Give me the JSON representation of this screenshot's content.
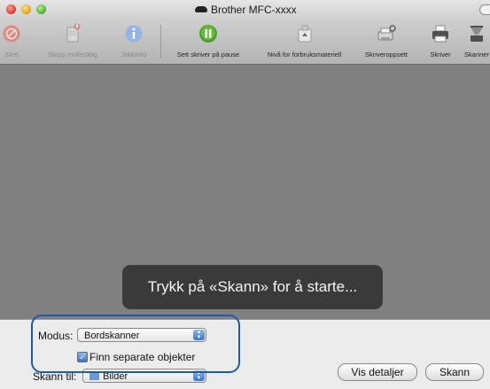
{
  "window": {
    "title": "Brother MFC-xxxx"
  },
  "toolbar": {
    "items": [
      {
        "label": "Slett",
        "icon": "delete-icon",
        "enabled": false
      },
      {
        "label": "Stopp midlertidig",
        "icon": "hold-icon",
        "enabled": false
      },
      {
        "label": "Jobbinfo",
        "icon": "info-icon",
        "enabled": false
      },
      {
        "label": "Sett skriver på pause",
        "icon": "pause-icon",
        "enabled": true
      },
      {
        "label": "Nivå for forbruksmateriell",
        "icon": "supply-levels-icon",
        "enabled": true
      },
      {
        "label": "Skriveroppsett",
        "icon": "printer-setup-icon",
        "enabled": true
      },
      {
        "label": "Skriver",
        "icon": "printer-icon",
        "enabled": true
      },
      {
        "label": "Skanner",
        "icon": "scanner-icon",
        "enabled": true
      }
    ]
  },
  "main": {
    "hint": "Trykk på «Skann» for å starte..."
  },
  "controls": {
    "mode_label": "Modus:",
    "mode_value": "Bordskanner",
    "detect_label": "Finn separate objekter",
    "detect_checked": true,
    "scan_to_label": "Skann til:",
    "scan_to_value": "Bilder",
    "details_button": "Vis detaljer",
    "scan_button": "Skann"
  },
  "colors": {
    "accent": "#1d5aa8",
    "pause_green": "#4aa028",
    "delete_red": "#c8463c",
    "info_blue": "#4a7fd0"
  }
}
